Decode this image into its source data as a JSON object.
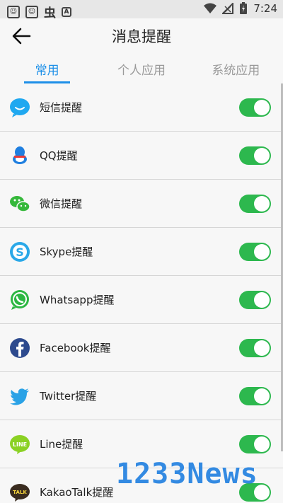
{
  "status_bar": {
    "time": "7:24"
  },
  "header": {
    "title": "消息提醒"
  },
  "tabs": [
    {
      "label": "常用",
      "active": true
    },
    {
      "label": "个人应用",
      "active": false
    },
    {
      "label": "系统应用",
      "active": false
    }
  ],
  "items": [
    {
      "label": "短信提醒",
      "icon": "sms-icon",
      "enabled": true
    },
    {
      "label": "QQ提醒",
      "icon": "qq-icon",
      "enabled": true
    },
    {
      "label": "微信提醒",
      "icon": "wechat-icon",
      "enabled": true
    },
    {
      "label": "Skype提醒",
      "icon": "skype-icon",
      "enabled": true
    },
    {
      "label": "Whatsapp提醒",
      "icon": "whatsapp-icon",
      "enabled": true
    },
    {
      "label": "Facebook提醒",
      "icon": "facebook-icon",
      "enabled": true
    },
    {
      "label": "Twitter提醒",
      "icon": "twitter-icon",
      "enabled": true
    },
    {
      "label": "Line提醒",
      "icon": "line-icon",
      "enabled": true
    },
    {
      "label": "KakaoTalk提醒",
      "icon": "kakaotalk-icon",
      "enabled": true
    }
  ],
  "watermark": "1233News",
  "colors": {
    "accent": "#1e90e8",
    "toggle_on": "#2db84e"
  }
}
